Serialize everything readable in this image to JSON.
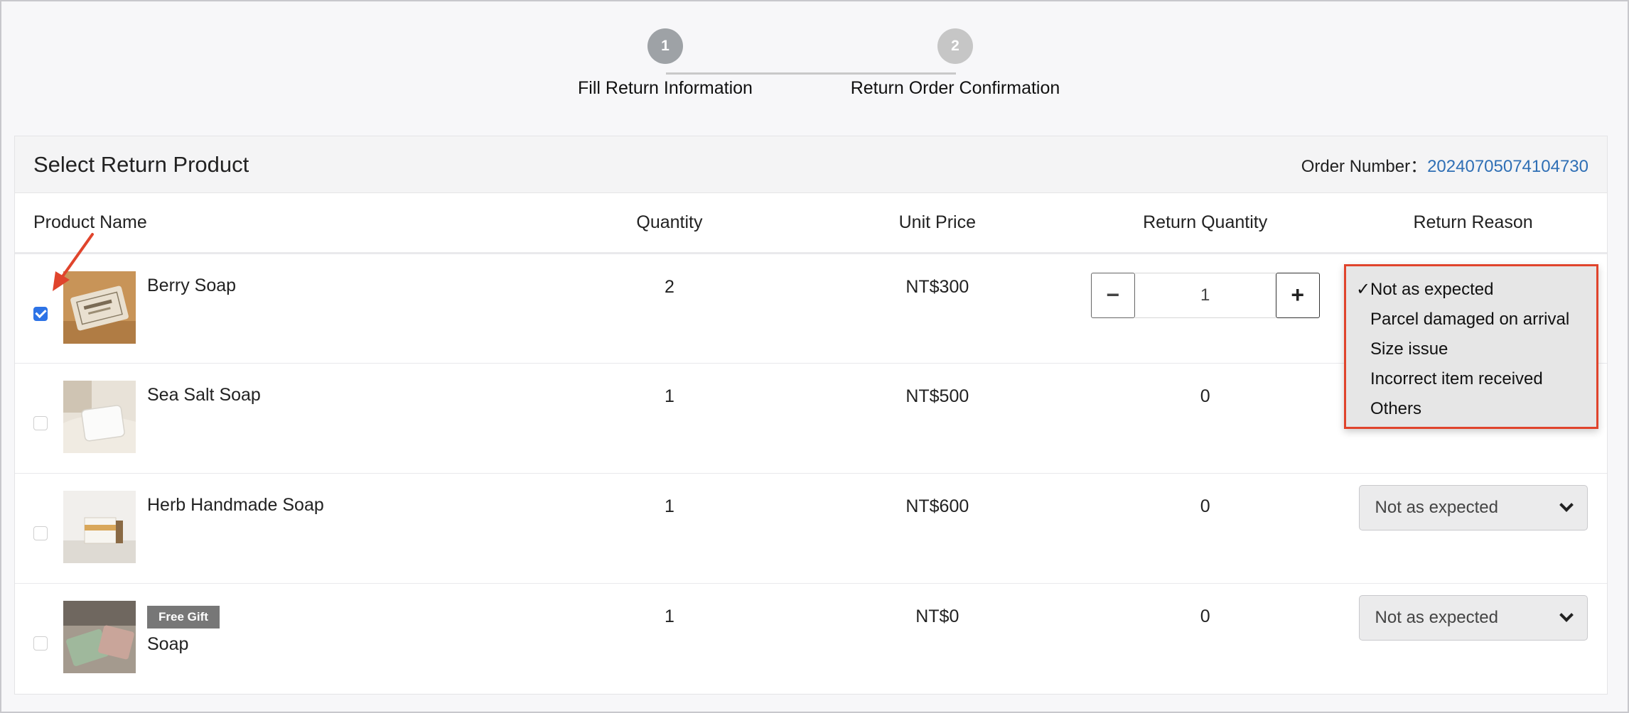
{
  "steps": [
    {
      "number": "1",
      "label": "Fill Return Information"
    },
    {
      "number": "2",
      "label": "Return Order Confirmation"
    }
  ],
  "card": {
    "title": "Select Return Product",
    "order_label": "Order Number：",
    "order_number": "20240705074104730"
  },
  "columns": {
    "name": "Product Name",
    "quantity": "Quantity",
    "unit_price": "Unit Price",
    "return_quantity": "Return Quantity",
    "return_reason": "Return Reason"
  },
  "rows": [
    {
      "name": "Berry Soap",
      "quantity": "2",
      "price": "NT$300",
      "return_qty": "1",
      "checked": true,
      "badge": ""
    },
    {
      "name": "Sea Salt Soap",
      "quantity": "1",
      "price": "NT$500",
      "return_qty": "0",
      "checked": false,
      "badge": ""
    },
    {
      "name": "Herb Handmade Soap",
      "quantity": "1",
      "price": "NT$600",
      "return_qty": "0",
      "checked": false,
      "badge": "",
      "reason": "Not as expected"
    },
    {
      "name": "Soap",
      "quantity": "1",
      "price": "NT$0",
      "return_qty": "0",
      "checked": false,
      "badge": "Free Gift",
      "reason": "Not as expected"
    }
  ],
  "qty_controls": {
    "minus": "−",
    "plus": "+"
  },
  "dropdown": {
    "selected_mark": "✓",
    "options": [
      "Not as expected",
      "Parcel damaged on arrival",
      "Size issue",
      "Incorrect item received",
      "Others"
    ]
  },
  "colors": {
    "accent": "#2f6fb5",
    "highlight": "#e0442c",
    "checkbox": "#2d73e6"
  }
}
